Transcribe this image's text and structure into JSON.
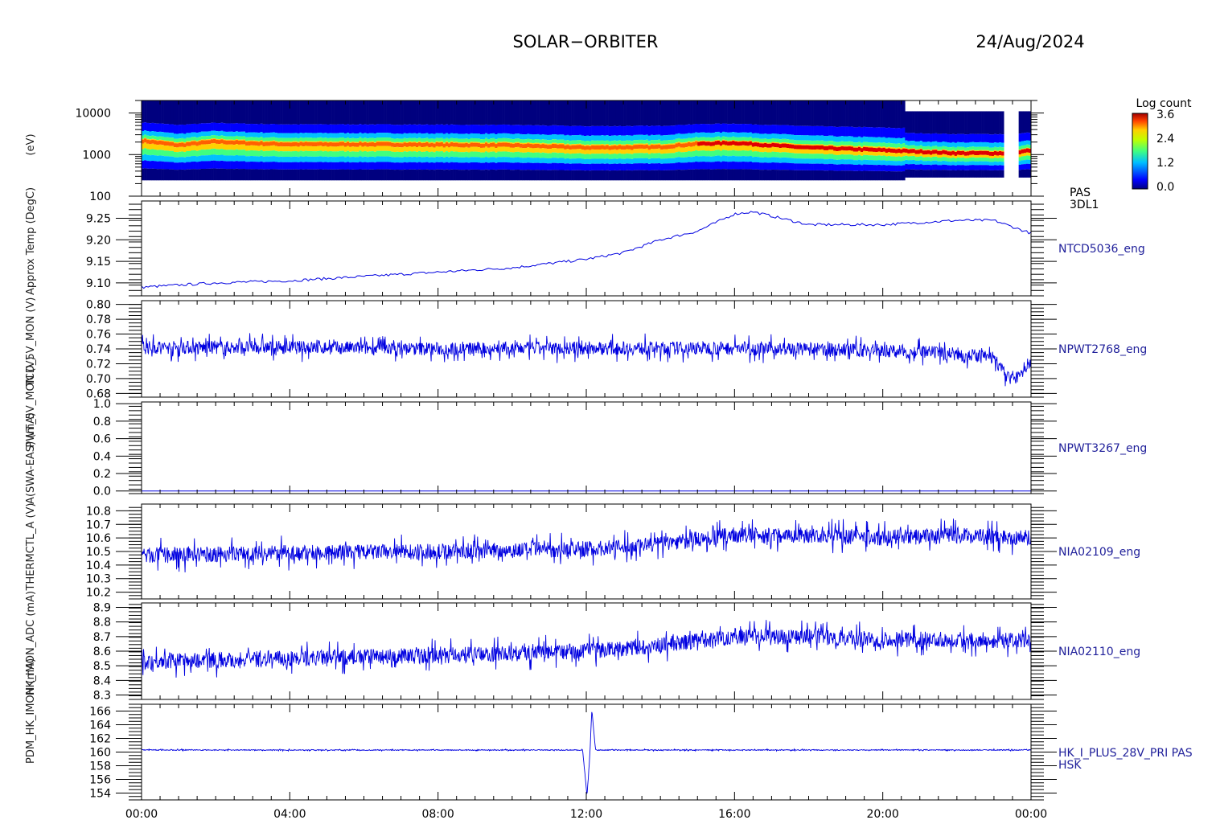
{
  "header": {
    "mission": "SOLAR−ORBITER",
    "date": "24/Aug/2024"
  },
  "colorbar": {
    "title": "Log count",
    "ticks": [
      "3.6",
      "2.4",
      "1.2",
      "0.0"
    ],
    "range": [
      0.0,
      3.6
    ]
  },
  "y_axis_titles": [
    "(eV)",
    "Approx Temp (DegC)",
    "TCD_5V_MON (V)",
    "PWT_5V_MON (V)",
    "A(SWA-EAS) (mA)",
    "THERMCTL_A (V)",
    "HK_IMON_ADC (mA)",
    "PDM_HK_IMON (mA)"
  ],
  "time_axis": {
    "ticks": [
      "00:00",
      "04:00",
      "08:00",
      "12:00",
      "16:00",
      "20:00",
      "00:00"
    ]
  },
  "chart_data": [
    {
      "type": "heatmap",
      "label": [
        "PAS",
        "3DL1"
      ],
      "y_scale": "log",
      "ylim": [
        100,
        20000
      ],
      "yticks": [
        "10000",
        "1000",
        "100"
      ],
      "x_hours": [
        0,
        24
      ],
      "peak_energy_eV_profile": [
        [
          0,
          2200
        ],
        [
          1,
          1700
        ],
        [
          2,
          2100
        ],
        [
          3,
          1900
        ],
        [
          4,
          1800
        ],
        [
          6,
          1800
        ],
        [
          8,
          1750
        ],
        [
          10,
          1700
        ],
        [
          12,
          1500
        ],
        [
          14,
          1550
        ],
        [
          15,
          1850
        ],
        [
          16,
          1950
        ],
        [
          17,
          1700
        ],
        [
          18,
          1500
        ],
        [
          20,
          1300
        ],
        [
          22,
          1100
        ],
        [
          23.5,
          1100
        ],
        [
          24,
          1300
        ]
      ],
      "colorscale": "Log count",
      "data_gap_hours": [
        23.25,
        23.65
      ]
    },
    {
      "type": "line",
      "label": "NTCD5036_eng",
      "ylim": [
        9.07,
        9.29
      ],
      "yticks": [
        "9.25",
        "9.20",
        "9.15",
        "9.10"
      ],
      "x": [
        0,
        2,
        4,
        6,
        8,
        10,
        12,
        13,
        14,
        15,
        16,
        16.5,
        17,
        18,
        20,
        22,
        23,
        23.5,
        24
      ],
      "y": [
        9.09,
        9.1,
        9.105,
        9.115,
        9.125,
        9.135,
        9.155,
        9.17,
        9.2,
        9.22,
        9.26,
        9.265,
        9.255,
        9.235,
        9.235,
        9.245,
        9.245,
        9.23,
        9.215
      ]
    },
    {
      "type": "line",
      "label": "NPWT2768_eng",
      "ylim": [
        0.675,
        0.805
      ],
      "yticks": [
        "0.80",
        "0.78",
        "0.76",
        "0.74",
        "0.72",
        "0.70",
        "0.68"
      ],
      "x": [
        0,
        4,
        8,
        12,
        16,
        20,
        22,
        23,
        23.3,
        23.6,
        24
      ],
      "y": [
        0.742,
        0.742,
        0.74,
        0.741,
        0.741,
        0.738,
        0.733,
        0.728,
        0.705,
        0.7,
        0.725
      ],
      "noise_amplitude": 0.02
    },
    {
      "type": "line",
      "label": "NPWT3267_eng",
      "ylim": [
        -0.03,
        1.02
      ],
      "yticks": [
        "1.0",
        "0.8",
        "0.6",
        "0.4",
        "0.2",
        "0.0"
      ],
      "x": [
        0,
        24
      ],
      "y": [
        0.0,
        0.0
      ]
    },
    {
      "type": "line",
      "label": "NIA02109_eng",
      "ylim": [
        10.15,
        10.85
      ],
      "yticks": [
        "10.8",
        "10.7",
        "10.6",
        "10.5",
        "10.4",
        "10.3",
        "10.2"
      ],
      "x": [
        0,
        4,
        8,
        12,
        13,
        14,
        16,
        18,
        20,
        22,
        24
      ],
      "y": [
        10.47,
        10.49,
        10.5,
        10.52,
        10.53,
        10.56,
        10.62,
        10.62,
        10.6,
        10.62,
        10.6
      ],
      "noise_amplitude": 0.13
    },
    {
      "type": "line",
      "label": "NIA02110_eng",
      "ylim": [
        8.27,
        8.93
      ],
      "yticks": [
        "8.9",
        "8.8",
        "8.7",
        "8.6",
        "8.5",
        "8.4",
        "8.3"
      ],
      "x": [
        0,
        4,
        8,
        12,
        14,
        16,
        18,
        20,
        22,
        24
      ],
      "y": [
        8.53,
        8.55,
        8.57,
        8.6,
        8.64,
        8.7,
        8.7,
        8.68,
        8.68,
        8.67
      ],
      "noise_amplitude": 0.12
    },
    {
      "type": "line",
      "label": [
        "HK_I_PLUS_28V_PRI PAS",
        "HSK"
      ],
      "ylim": [
        153,
        167
      ],
      "yticks": [
        "166",
        "164",
        "162",
        "160",
        "158",
        "156",
        "154"
      ],
      "x": [
        0,
        11.9,
        12.02,
        12.1,
        12.15,
        12.25,
        12.4,
        24
      ],
      "y": [
        160.3,
        160.3,
        153.6,
        160.0,
        166.2,
        160.3,
        160.3,
        160.3
      ],
      "noise_amplitude": 0.15
    }
  ]
}
